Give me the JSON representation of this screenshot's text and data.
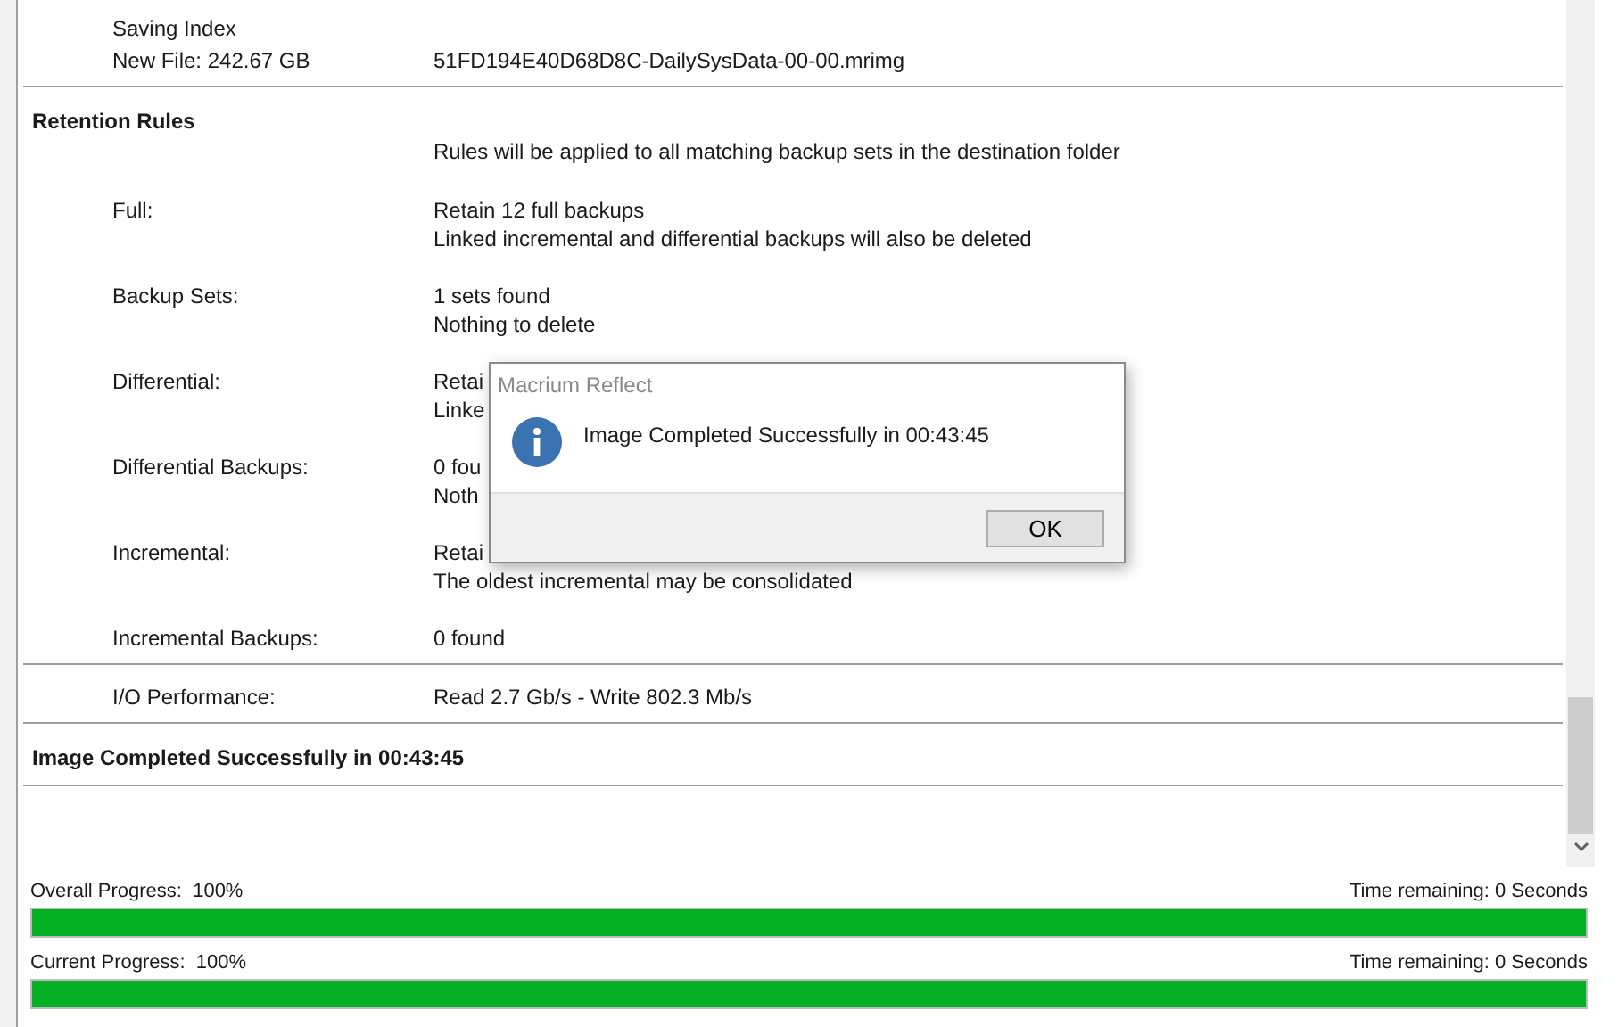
{
  "log": [
    {
      "kind": "pair",
      "label": "Saving Index"
    },
    {
      "kind": "pair",
      "label": "New File: 242.67 GB",
      "lines": [
        "51FD194E40D68D8C-DailySysData-00-00.mrimg"
      ]
    },
    {
      "kind": "rule"
    },
    {
      "kind": "heading",
      "text": "Retention Rules"
    },
    {
      "kind": "note",
      "lines": [
        "Rules will be applied to all matching backup sets in the destination folder"
      ]
    },
    {
      "kind": "pair",
      "label": "Full:",
      "lines": [
        "Retain 12 full backups",
        "Linked incremental and differential backups will also be deleted"
      ]
    },
    {
      "kind": "pair",
      "label": "Backup Sets:",
      "lines": [
        "1 sets found",
        "Nothing to delete"
      ]
    },
    {
      "kind": "pair",
      "label": "Differential:",
      "lines": [
        "Retai",
        "Linke"
      ]
    },
    {
      "kind": "pair",
      "label": "Differential Backups:",
      "lines": [
        "0 fou",
        "Noth"
      ]
    },
    {
      "kind": "pair",
      "label": "Incremental:",
      "lines": [
        "Retai",
        "The oldest incremental may be consolidated"
      ]
    },
    {
      "kind": "pair",
      "label": "Incremental Backups:",
      "lines": [
        "0 found"
      ]
    },
    {
      "kind": "rule"
    },
    {
      "kind": "pair",
      "label": "I/O Performance:",
      "lines": [
        "Read 2.7 Gb/s - Write 802.3 Mb/s"
      ]
    },
    {
      "kind": "rule"
    },
    {
      "kind": "heading",
      "text": "Image Completed Successfully in 00:43:45"
    },
    {
      "kind": "rule"
    }
  ],
  "progress": [
    {
      "label": "Overall Progress:",
      "percent": "100%",
      "remaining": "Time remaining: 0 Seconds",
      "level": 1
    },
    {
      "label": "Current Progress:",
      "percent": "100%",
      "remaining": "Time remaining: 0 Seconds",
      "level": 1
    }
  ],
  "dialog": {
    "title": "Macrium Reflect",
    "message": "Image Completed Successfully in 00:43:45",
    "button": "OK"
  }
}
